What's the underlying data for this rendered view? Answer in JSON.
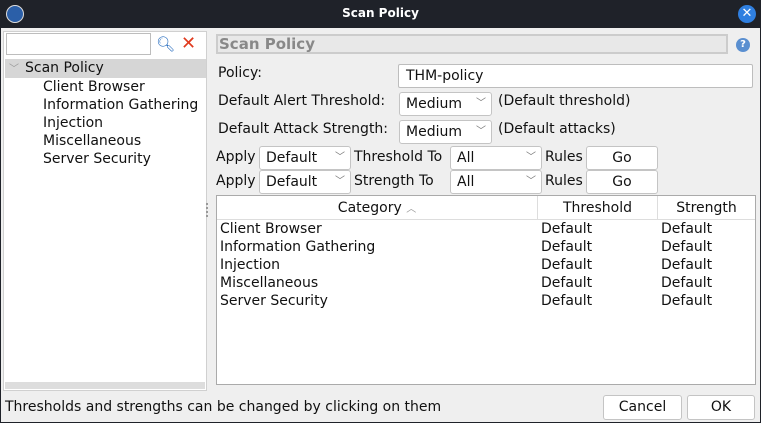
{
  "window": {
    "title": "Scan Policy",
    "close_icon": "close-icon"
  },
  "left": {
    "search_value": "",
    "tree": {
      "root": "Scan Policy",
      "children": [
        "Client Browser",
        "Information Gathering",
        "Injection",
        "Miscellaneous",
        "Server Security"
      ]
    }
  },
  "right": {
    "header": "Scan Policy",
    "policy_label": "Policy:",
    "policy_value": "THM-policy",
    "alert_label": "Default Alert Threshold:",
    "alert_value": "Medium",
    "alert_note": "(Default threshold)",
    "attack_label": "Default Attack Strength:",
    "attack_value": "Medium",
    "attack_note": "(Default attacks)",
    "apply1": {
      "apply": "Apply",
      "value": "Default",
      "mid": "Threshold To",
      "to": "All",
      "rules": "Rules",
      "go": "Go"
    },
    "apply2": {
      "apply": "Apply",
      "value": "Default",
      "mid": "Strength To",
      "to": "All",
      "rules": "Rules",
      "go": "Go"
    },
    "table": {
      "columns": [
        "Category",
        "Threshold",
        "Strength"
      ],
      "sort_indicator": "^",
      "rows": [
        [
          "Client Browser",
          "Default",
          "Default"
        ],
        [
          "Information Gathering",
          "Default",
          "Default"
        ],
        [
          "Injection",
          "Default",
          "Default"
        ],
        [
          "Miscellaneous",
          "Default",
          "Default"
        ],
        [
          "Server Security",
          "Default",
          "Default"
        ]
      ]
    }
  },
  "footer": {
    "status": "Thresholds and strengths can be changed by clicking on them",
    "cancel": "Cancel",
    "ok": "OK"
  }
}
